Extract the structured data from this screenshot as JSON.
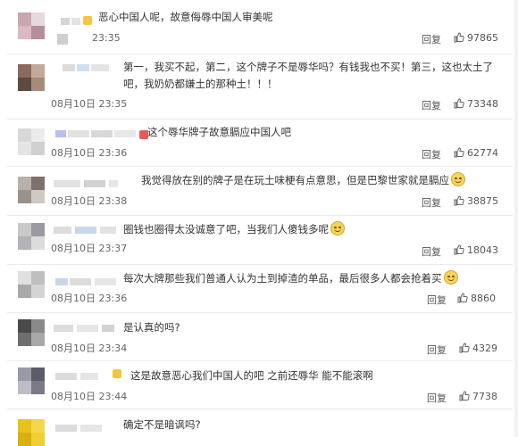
{
  "comments": [
    {
      "text": "恶心中国人呢，故意侮辱中国人审美呢",
      "time": "23:35",
      "reply": "回复",
      "likes": "97865",
      "emoji": false
    },
    {
      "text": "第一，我买不起，第二，这个牌子不是辱华吗？有钱我也不买！第三，这也太土了吧，我奶奶都嫌土的那种土！！！",
      "time": "08月10日 23:35",
      "reply": "回复",
      "likes": "73348",
      "emoji": false
    },
    {
      "text": "这个辱华牌子故意膈应中国人吧",
      "time": "08月10日 23:36",
      "reply": "回复",
      "likes": "62774",
      "emoji": false
    },
    {
      "text": "我觉得放在别的牌子是在玩土味梗有点意思，但是巴黎世家就是膈应",
      "time": "08月10日 23:38",
      "reply": "回复",
      "likes": "38875",
      "emoji": true
    },
    {
      "text": "圈钱也圈得太没诚意了吧，当我们人傻钱多呢",
      "time": "08月10日 23:37",
      "reply": "回复",
      "likes": "18043",
      "emoji": true
    },
    {
      "text": "每次大牌那些我们普通人认为土到掉渣的单品，最后很多人都会抢着买",
      "time": "08月10日 23:36",
      "reply": "回复",
      "likes": "8860",
      "emoji": true
    },
    {
      "text": "是认真的吗?",
      "time": "08月10日 23:34",
      "reply": "回复",
      "likes": "4329",
      "emoji": false
    },
    {
      "text": "这是故意恶心我们中国人的吧 之前还辱华 能不能滚啊",
      "time": "08月10日 23:44",
      "reply": "回复",
      "likes": "7738",
      "emoji": false
    },
    {
      "text": "确定不是暗讽吗?",
      "time": "",
      "reply": "",
      "likes": "",
      "emoji": false
    }
  ],
  "icons": {
    "like": "thumbs-up-icon",
    "emoji": "grin-emoji-icon"
  },
  "colors": {
    "divider": "#ececec",
    "text": "#333333",
    "muted": "#666666"
  }
}
